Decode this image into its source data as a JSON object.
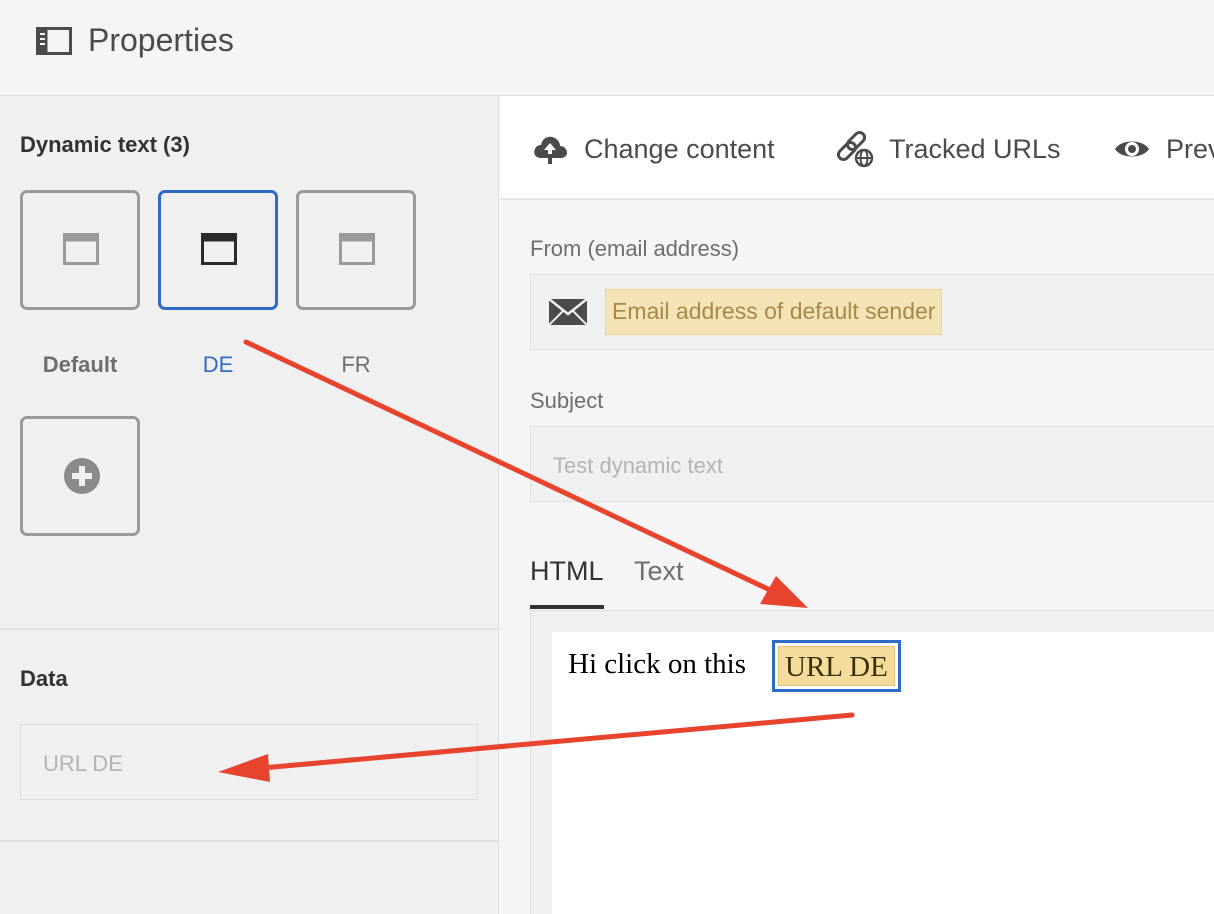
{
  "header": {
    "title": "Properties",
    "icon": "panel-icon"
  },
  "dynamic_text": {
    "title": "Dynamic text (3)",
    "variants": [
      {
        "label": "Default",
        "icon": "window-icon",
        "selected": false
      },
      {
        "label": "DE",
        "icon": "window-icon",
        "selected": true
      },
      {
        "label": "FR",
        "icon": "window-icon",
        "selected": false
      }
    ],
    "add_icon": "plus-circle-icon"
  },
  "data_section": {
    "title": "Data",
    "placeholder": "URL DE"
  },
  "toolbar": {
    "items": [
      {
        "label": "Change content",
        "icon": "cloud-upload-icon"
      },
      {
        "label": "Tracked URLs",
        "icon": "link-globe-icon"
      },
      {
        "label": "Prev",
        "icon": "eye-icon"
      }
    ]
  },
  "form": {
    "from_label": "From (email address)",
    "from_value": "Email address of default sender",
    "from_icon": "envelope-icon",
    "subject_label": "Subject",
    "subject_placeholder": "Test dynamic text"
  },
  "tabs": [
    {
      "label": "HTML",
      "active": true
    },
    {
      "label": "Text",
      "active": false
    }
  ],
  "editor": {
    "text": "Hi click on this",
    "link_text": "URL DE"
  },
  "colors": {
    "accent": "#2d6bc7",
    "annotation_arrow": "#e8432d",
    "highlight": "#f4dd9c"
  }
}
